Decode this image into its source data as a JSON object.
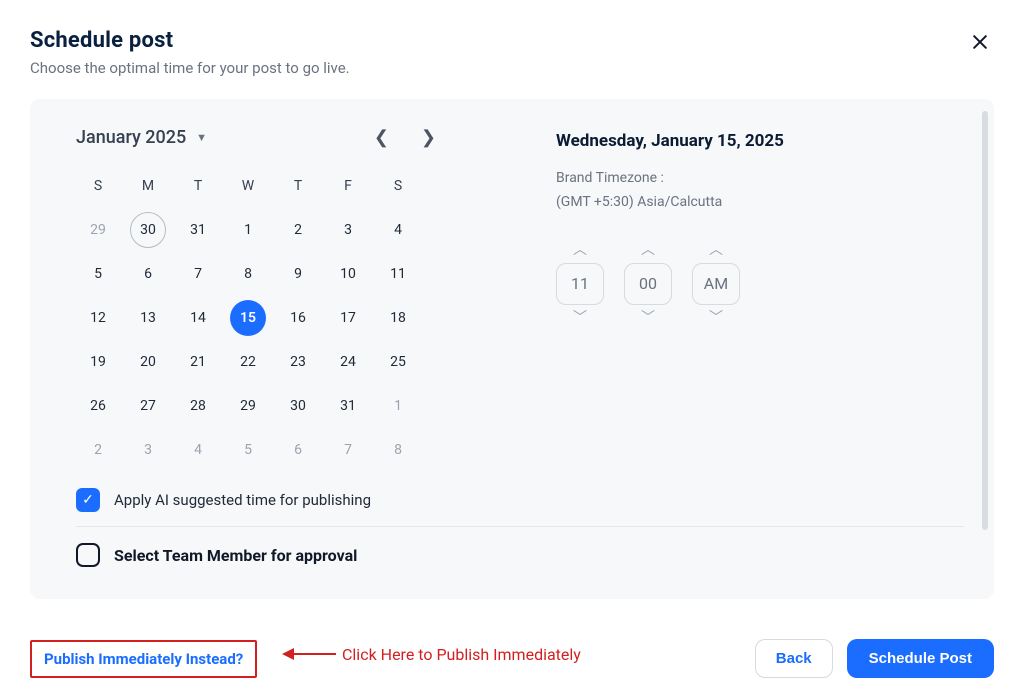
{
  "header": {
    "title": "Schedule post",
    "subtitle": "Choose the optimal time for your post to go live."
  },
  "calendar": {
    "month_label": "January 2025",
    "dow": [
      "S",
      "M",
      "T",
      "W",
      "T",
      "F",
      "S"
    ],
    "cells": [
      {
        "n": "29",
        "muted": true
      },
      {
        "n": "30",
        "today": true
      },
      {
        "n": "31"
      },
      {
        "n": "1"
      },
      {
        "n": "2"
      },
      {
        "n": "3"
      },
      {
        "n": "4"
      },
      {
        "n": "5"
      },
      {
        "n": "6"
      },
      {
        "n": "7"
      },
      {
        "n": "8"
      },
      {
        "n": "9"
      },
      {
        "n": "10"
      },
      {
        "n": "11"
      },
      {
        "n": "12"
      },
      {
        "n": "13"
      },
      {
        "n": "14"
      },
      {
        "n": "15",
        "selected": true
      },
      {
        "n": "16"
      },
      {
        "n": "17"
      },
      {
        "n": "18"
      },
      {
        "n": "19"
      },
      {
        "n": "20"
      },
      {
        "n": "21"
      },
      {
        "n": "22"
      },
      {
        "n": "23"
      },
      {
        "n": "24"
      },
      {
        "n": "25"
      },
      {
        "n": "26"
      },
      {
        "n": "27"
      },
      {
        "n": "28"
      },
      {
        "n": "29"
      },
      {
        "n": "30"
      },
      {
        "n": "31"
      },
      {
        "n": "1",
        "muted": true
      },
      {
        "n": "2",
        "muted": true
      },
      {
        "n": "3",
        "muted": true
      },
      {
        "n": "4",
        "muted": true
      },
      {
        "n": "5",
        "muted": true
      },
      {
        "n": "6",
        "muted": true
      },
      {
        "n": "7",
        "muted": true
      },
      {
        "n": "8",
        "muted": true
      }
    ]
  },
  "options": {
    "ai_label": "Apply AI suggested time for publishing",
    "approval_label": "Select Team Member for approval"
  },
  "right": {
    "selected_date": "Wednesday, January 15, 2025",
    "tz_label": "Brand Timezone :",
    "tz_value": "(GMT +5:30) Asia/Calcutta",
    "time": {
      "hour": "11",
      "minute": "00",
      "ampm": "AM"
    }
  },
  "footer": {
    "publish_link": "Publish Immediately Instead?",
    "back": "Back",
    "schedule": "Schedule Post"
  },
  "annotation": {
    "text": "Click Here to Publish Immediately"
  }
}
